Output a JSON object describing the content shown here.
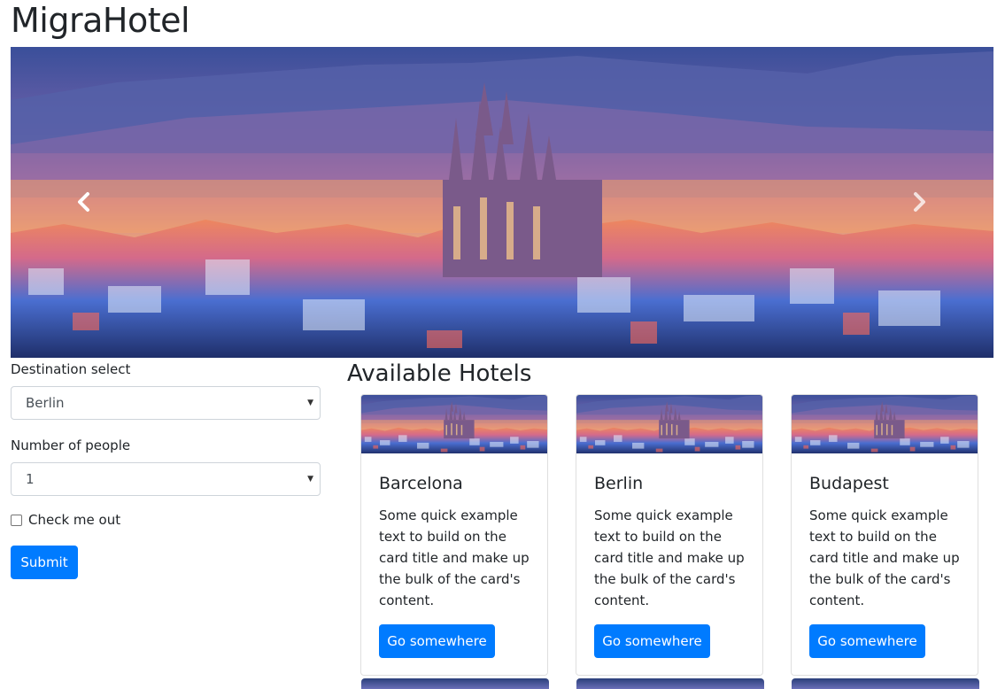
{
  "app": {
    "title": "MigraHotel"
  },
  "carousel": {
    "prev_icon": "chevron-left-icon",
    "next_icon": "chevron-right-icon"
  },
  "form": {
    "destination_label": "Destination select",
    "destination_value": "Berlin",
    "people_label": "Number of people",
    "people_value": "1",
    "checkbox_label": "Check me out",
    "checkbox_checked": false,
    "submit_label": "Submit"
  },
  "hotels": {
    "heading": "Available Hotels",
    "cards": [
      {
        "title": "Barcelona",
        "text": "Some quick example text to build on the card title and make up the bulk of the card's content.",
        "button": "Go somewhere"
      },
      {
        "title": "Berlin",
        "text": "Some quick example text to build on the card title and make up the bulk of the card's content.",
        "button": "Go somewhere"
      },
      {
        "title": "Budapest",
        "text": "Some quick example text to build on the card title and make up the bulk of the card's content.",
        "button": "Go somewhere"
      }
    ]
  },
  "colors": {
    "primary": "#007bff",
    "text": "#212529",
    "border": "#ced4da"
  }
}
